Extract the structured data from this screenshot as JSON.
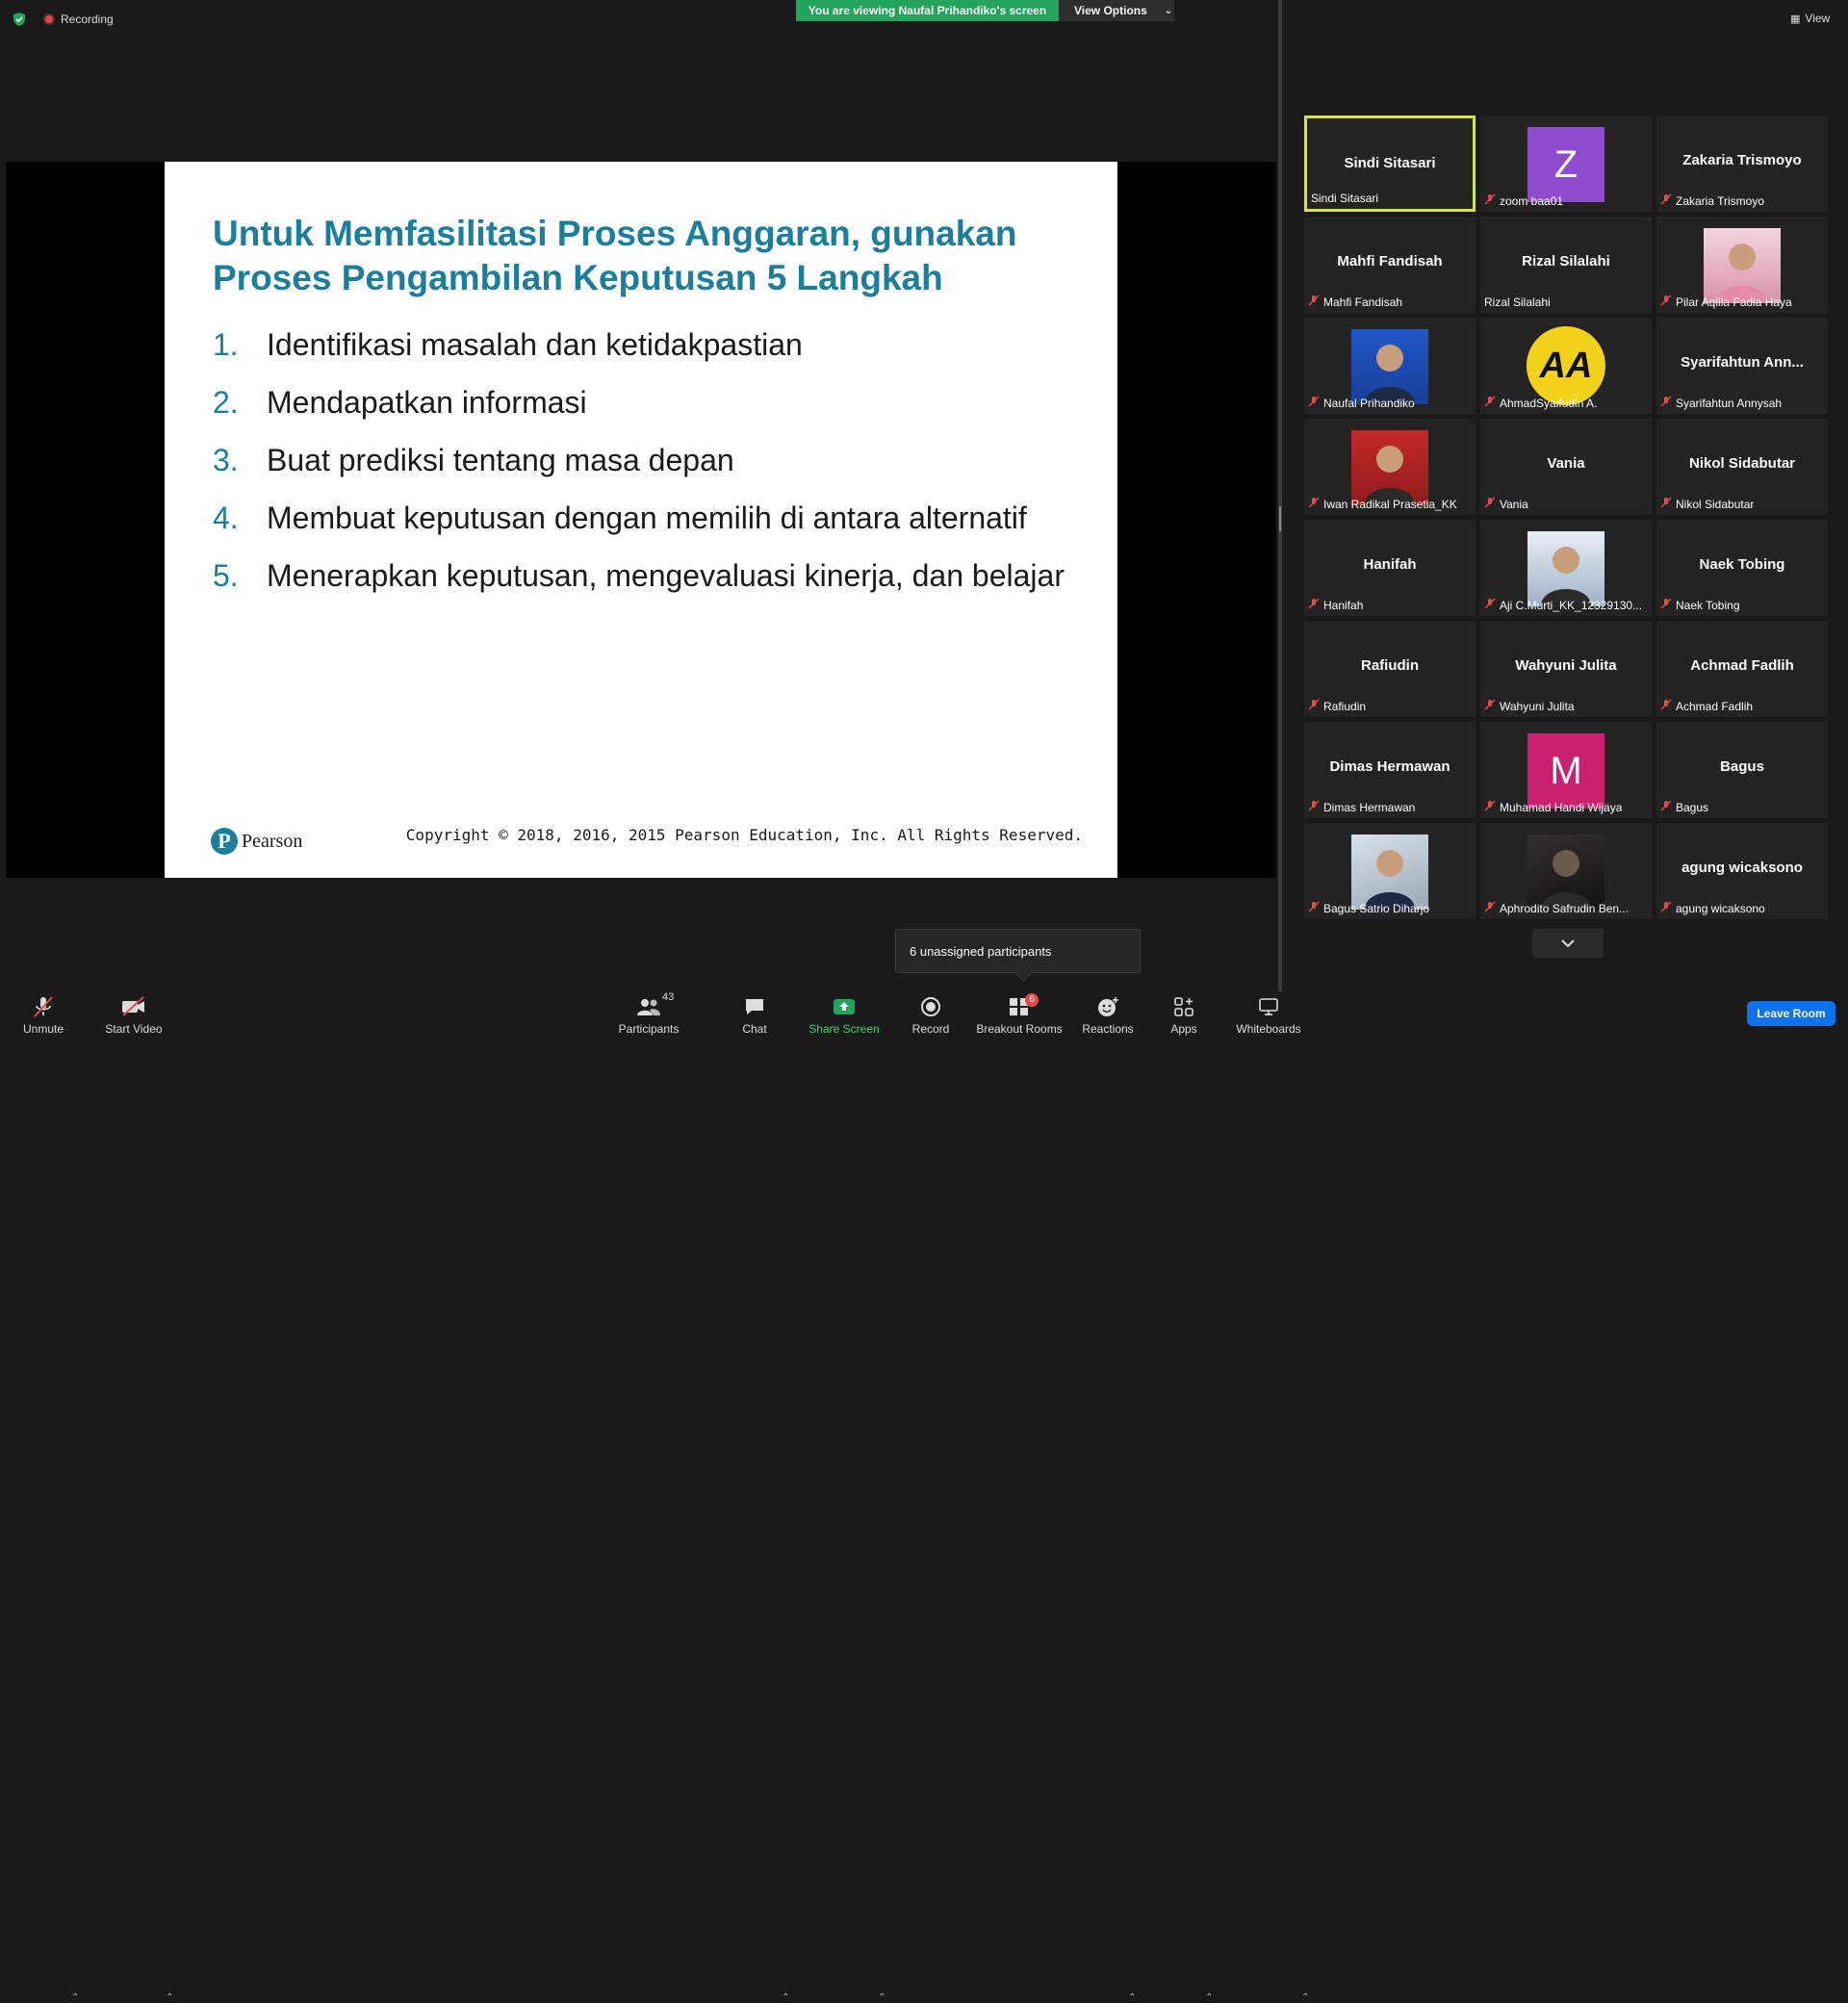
{
  "header": {
    "recording_label": "Recording",
    "viewing_banner": "You are viewing Naufal Prihandiko's screen",
    "view_options_label": "View Options",
    "gallery_view_label": "View"
  },
  "slide": {
    "title": "Untuk Memfasilitasi Proses Anggaran, gunakan Proses Pengambilan Keputusan 5 Langkah",
    "items": [
      {
        "num": "1.",
        "text": "Identifikasi masalah dan ketidakpastian"
      },
      {
        "num": "2.",
        "text": "Mendapatkan informasi"
      },
      {
        "num": "3.",
        "text": "Buat prediksi tentang masa depan"
      },
      {
        "num": "4.",
        "text": "Membuat keputusan dengan memilih di antara alternatif"
      },
      {
        "num": "5.",
        "text": "Menerapkan keputusan, mengevaluasi kinerja, dan belajar"
      }
    ],
    "logo_text": "Pearson",
    "copyright": "Copyright © 2018, 2016, 2015 Pearson Education, Inc. All Rights Reserved."
  },
  "gallery": {
    "tiles": [
      {
        "big": "Sindi Sitasari",
        "label": "Sindi Sitasari",
        "muted": false,
        "avatar": "none",
        "active": true
      },
      {
        "big": "",
        "label": "zoom baa01",
        "muted": true,
        "avatar": "letter",
        "letter": "Z",
        "color": "#8e4ccf"
      },
      {
        "big": "Zakaria Trismoyo",
        "label": "Zakaria Trismoyo",
        "muted": true,
        "avatar": "none"
      },
      {
        "big": "Mahfi Fandisah",
        "label": "Mahfi Fandisah",
        "muted": true,
        "avatar": "none"
      },
      {
        "big": "Rizal Silalahi",
        "label": "Rizal Silalahi",
        "muted": false,
        "avatar": "none"
      },
      {
        "big": "",
        "label": "Pilar Aqilla Fadia Haya",
        "muted": true,
        "avatar": "photo-pink"
      },
      {
        "big": "",
        "label": "Naufal Prihandiko",
        "muted": true,
        "avatar": "photo-blue"
      },
      {
        "big": "",
        "label": "AhmadSyaifudin A.",
        "muted": true,
        "avatar": "aa",
        "letter": "AA"
      },
      {
        "big": "Syarifahtun  Ann...",
        "label": "Syarifahtun Annysah",
        "muted": true,
        "avatar": "none"
      },
      {
        "big": "",
        "label": "Iwan Radikal Prasetia_KK",
        "muted": true,
        "avatar": "photo-red"
      },
      {
        "big": "Vania",
        "label": "Vania",
        "muted": true,
        "avatar": "none"
      },
      {
        "big": "Nikol Sidabutar",
        "label": "Nikol Sidabutar",
        "muted": true,
        "avatar": "none"
      },
      {
        "big": "Hanifah",
        "label": "Hanifah",
        "muted": true,
        "avatar": "none"
      },
      {
        "big": "",
        "label": "Aji C.Murti_KK_12329130...",
        "muted": true,
        "avatar": "photo-shop"
      },
      {
        "big": "Naek Tobing",
        "label": "Naek Tobing",
        "muted": true,
        "avatar": "none"
      },
      {
        "big": "Rafiudin",
        "label": "Rafiudin",
        "muted": true,
        "avatar": "none"
      },
      {
        "big": "Wahyuni Julita",
        "label": "Wahyuni Julita",
        "muted": true,
        "avatar": "none"
      },
      {
        "big": "Achmad Fadlih",
        "label": "Achmad Fadlih",
        "muted": true,
        "avatar": "none"
      },
      {
        "big": "Dimas Hermawan",
        "label": "Dimas Hermawan",
        "muted": true,
        "avatar": "none"
      },
      {
        "big": "",
        "label": "Muhamad Handi Wijaya",
        "muted": true,
        "avatar": "letter",
        "letter": "M",
        "color": "#c9206f"
      },
      {
        "big": "Bagus",
        "label": "Bagus",
        "muted": true,
        "avatar": "none"
      },
      {
        "big": "",
        "label": "Bagus Satrio Diharjo",
        "muted": true,
        "avatar": "photo-light"
      },
      {
        "big": "",
        "label": "Aphrodito Safrudin Ben...",
        "muted": true,
        "avatar": "photo-dark"
      },
      {
        "big": "agung wicaksono",
        "label": "agung wicaksono",
        "muted": true,
        "avatar": "none"
      }
    ]
  },
  "tooltip": {
    "text": "6 unassigned participants"
  },
  "toolbar": {
    "unmute": "Unmute",
    "start_video": "Start Video",
    "participants": "Participants",
    "participants_count": "43",
    "chat": "Chat",
    "share_screen": "Share Screen",
    "record": "Record",
    "breakout_rooms": "Breakout Rooms",
    "breakout_badge": "6",
    "reactions": "Reactions",
    "apps": "Apps",
    "whiteboards": "Whiteboards",
    "leave_room": "Leave Room"
  },
  "colors": {
    "banner_green": "#23a45d",
    "slide_title_teal": "#1b7f9b",
    "active_speaker_yellow": "#d7e43b",
    "leave_blue": "#0e72ed",
    "mute_red": "#e24b4b"
  }
}
